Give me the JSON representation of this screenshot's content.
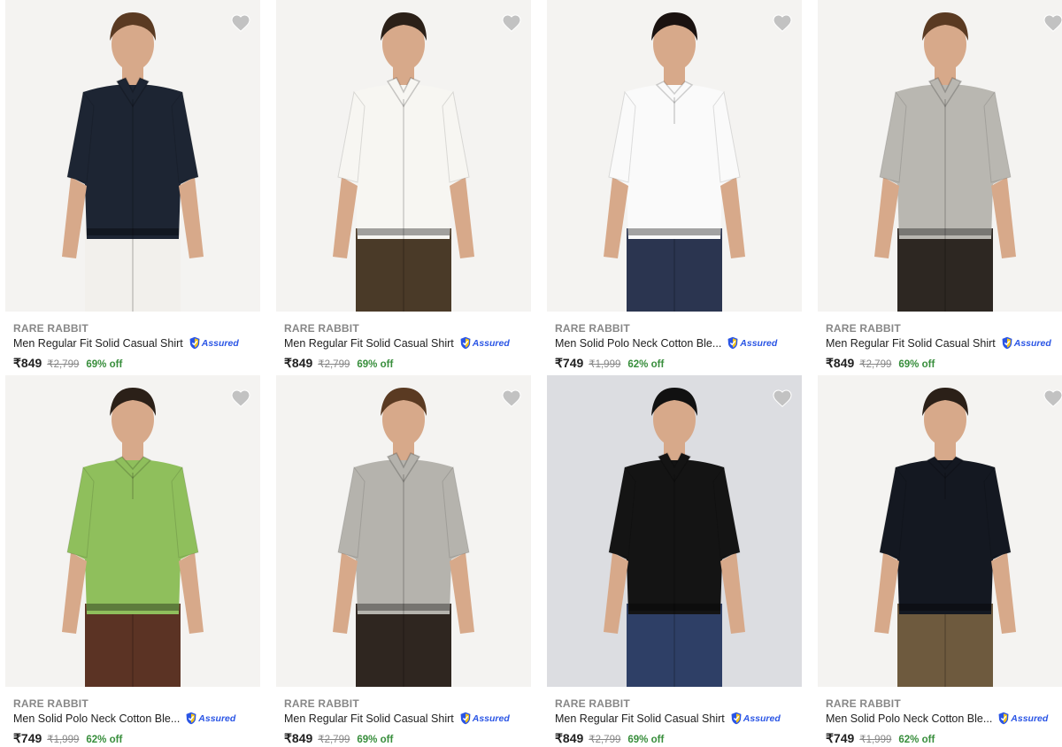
{
  "badge": {
    "label": "Assured"
  },
  "products": [
    {
      "brand": "RARE RABBIT",
      "title": "Men Regular Fit Solid Casual Shirt",
      "price": "₹849",
      "mrp": "₹2,799",
      "discount": "69% off",
      "shirt_color": "#1d2533",
      "pants_color": "#f2f0ec",
      "collar": "shirt",
      "bg": "light",
      "hair": "#5a3a22"
    },
    {
      "brand": "RARE RABBIT",
      "title": "Men Regular Fit Solid Casual Shirt",
      "price": "₹849",
      "mrp": "₹2,799",
      "discount": "69% off",
      "shirt_color": "#f7f6f2",
      "pants_color": "#4a3a28",
      "collar": "shirt",
      "bg": "light",
      "hair": "#2b2018"
    },
    {
      "brand": "RARE RABBIT",
      "title": "Men Solid Polo Neck Cotton Ble...",
      "price": "₹749",
      "mrp": "₹1,999",
      "discount": "62% off",
      "shirt_color": "#fafafa",
      "pants_color": "#2b3550",
      "collar": "polo",
      "bg": "light",
      "hair": "#1a1210"
    },
    {
      "brand": "RARE RABBIT",
      "title": "Men Regular Fit Solid Casual Shirt",
      "price": "₹849",
      "mrp": "₹2,799",
      "discount": "69% off",
      "shirt_color": "#b9b7b1",
      "pants_color": "#2d2722",
      "collar": "shirt",
      "bg": "light",
      "hair": "#5a3a22"
    },
    {
      "brand": "RARE RABBIT",
      "title": "Men Solid Polo Neck Cotton Ble...",
      "price": "₹749",
      "mrp": "₹1,999",
      "discount": "62% off",
      "shirt_color": "#8fbf5c",
      "pants_color": "#5b3324",
      "collar": "polo",
      "bg": "light",
      "hair": "#2b2018"
    },
    {
      "brand": "RARE RABBIT",
      "title": "Men Regular Fit Solid Casual Shirt",
      "price": "₹849",
      "mrp": "₹2,799",
      "discount": "69% off",
      "shirt_color": "#b5b3ad",
      "pants_color": "#2f2620",
      "collar": "shirt",
      "bg": "light",
      "hair": "#5a3a22"
    },
    {
      "brand": "RARE RABBIT",
      "title": "Men Regular Fit Solid Casual Shirt",
      "price": "₹849",
      "mrp": "₹2,799",
      "discount": "69% off",
      "shirt_color": "#141414",
      "pants_color": "#2e3f66",
      "collar": "shirt",
      "bg": "dark",
      "hair": "#111111"
    },
    {
      "brand": "RARE RABBIT",
      "title": "Men Solid Polo Neck Cotton Ble...",
      "price": "₹749",
      "mrp": "₹1,999",
      "discount": "62% off",
      "shirt_color": "#141821",
      "pants_color": "#6e5a3e",
      "collar": "polo",
      "bg": "light",
      "hair": "#2b2018"
    }
  ]
}
